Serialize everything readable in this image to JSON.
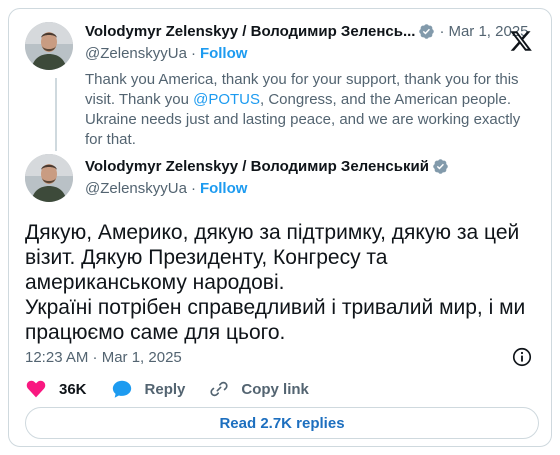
{
  "quoted_post": {
    "author_name": "Volodymyr Zelenskyy / Володимир Зеленсь...",
    "handle": "@ZelenskyyUa",
    "follow_label": "Follow",
    "separator": "·",
    "date": "Mar 1, 2025",
    "text_before_mention": "Thank you America, thank you for your support, thank you for this visit. Thank you ",
    "mention": "@POTUS",
    "text_after_mention": ", Congress, and the American people. Ukraine needs just and lasting peace, and we are working exactly for that."
  },
  "main_post": {
    "author_name": "Volodymyr Zelenskyy / Володимир Зеленський",
    "handle": "@ZelenskyyUa",
    "follow_label": "Follow",
    "separator": "·",
    "text_line_1": "Дякую, Америко, дякую за підтримку, дякую за цей візит. Дякую Президенту, Конгресу та американському народові.",
    "text_line_2": "Україні потрібен справедливий і тривалий мир, і ми працюємо саме для цього.",
    "timestamp": "12:23 AM · Mar 1, 2025"
  },
  "actions": {
    "likes_count": "36K",
    "reply_label": "Reply",
    "copy_link_label": "Copy link"
  },
  "replies_button_label": "Read 2.7K replies",
  "colors": {
    "accent": "#1d9bf0",
    "heart": "#f91880",
    "muted": "#536471",
    "border": "#cfd9de"
  },
  "icons": [
    "x-logo-icon",
    "verified-badge-icon",
    "info-icon",
    "heart-icon",
    "reply-icon",
    "link-icon"
  ]
}
